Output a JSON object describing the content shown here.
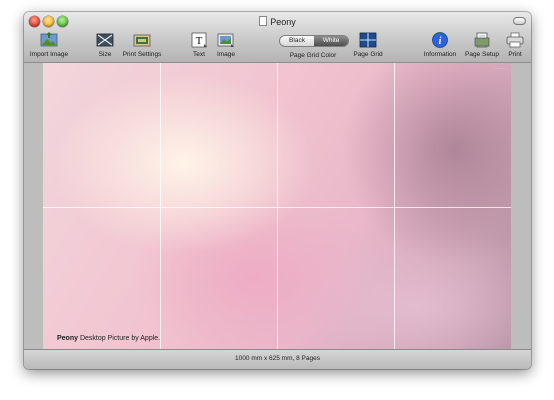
{
  "window": {
    "title": "Peony"
  },
  "toolbar": {
    "import_image": "Import Image",
    "size": "Size",
    "print_settings": "Print Settings",
    "text": "Text",
    "image": "Image",
    "page_grid_color": {
      "label": "Page Grid Color",
      "options": [
        "Black",
        "White"
      ],
      "selected": "White"
    },
    "page_grid": "Page Grid",
    "information": "Information",
    "page_setup": "Page Setup",
    "print": "Print"
  },
  "document": {
    "caption_bold": "Peony",
    "caption_rest": " Desktop Picture by Apple.",
    "grid": {
      "columns": 4,
      "rows": 2
    }
  },
  "status": {
    "text": "1000 mm  x  625 mm, 8 Pages"
  },
  "colors": {
    "accent_info": "#2f63d6",
    "selected_segment": "#5a5a5a"
  }
}
